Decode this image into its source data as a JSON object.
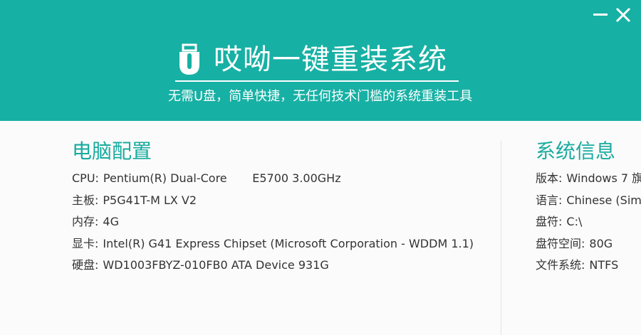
{
  "window": {
    "minimize_icon": "minimize-icon",
    "close_icon": "close-icon"
  },
  "brand": {
    "title": "哎呦一键重装系统",
    "slogan": "无需U盘，简单快捷，无任何技术门槛的系统重装工具",
    "logo_icon": "usb-drive-icon"
  },
  "hardware": {
    "title": "电脑配置",
    "items": [
      {
        "label": "CPU:",
        "value": "Pentium(R) Dual-Core       E5700 3.00GHz"
      },
      {
        "label": "主板:",
        "value": "P5G41T-M LX V2"
      },
      {
        "label": "内存:",
        "value": "4G"
      },
      {
        "label": "显卡:",
        "value": "Intel(R) G41 Express Chipset (Microsoft Corporation - WDDM 1.1)"
      },
      {
        "label": "硬盘:",
        "value": "WD1003FBYZ-010FB0 ATA Device 931G"
      }
    ]
  },
  "system": {
    "title": "系统信息",
    "items": [
      {
        "label": "版本:",
        "value": "Windows 7 旗"
      },
      {
        "label": "语言:",
        "value": "Chinese (Simp"
      },
      {
        "label": "盘符:",
        "value": "C:\\"
      },
      {
        "label": "盘符空间:",
        "value": "80G"
      },
      {
        "label": "文件系统:",
        "value": "NTFS"
      }
    ]
  },
  "colors": {
    "header_bg": "#17b0a4",
    "accent": "#19ab9f",
    "text": "#333333",
    "body_bg": "#fbfbfb"
  }
}
